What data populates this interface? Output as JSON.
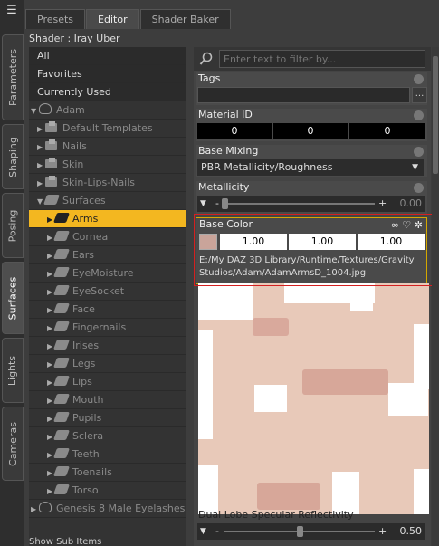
{
  "tabs": [
    "Presets",
    "Editor",
    "Shader Baker"
  ],
  "side_tabs": [
    "Parameters",
    "Shaping",
    "Posing",
    "Surfaces",
    "Lights",
    "Cameras"
  ],
  "shader_label": "Shader : Iray Uber",
  "tree": {
    "all": "All",
    "favorites": "Favorites",
    "currently_used": "Currently Used",
    "figure": "Adam",
    "folders": [
      "Default Templates",
      "Nails",
      "Skin",
      "Skin-Lips-Nails"
    ],
    "surfaces": "Surfaces",
    "selected": "Arms",
    "items": [
      "Cornea",
      "Ears",
      "EyeMoisture",
      "EyeSocket",
      "Face",
      "Fingernails",
      "Irises",
      "Legs",
      "Lips",
      "Mouth",
      "Pupils",
      "Sclera",
      "Teeth",
      "Toenails",
      "Torso"
    ],
    "next_figure": "Genesis 8 Male Eyelashes",
    "show_sub_items": "Show Sub Items"
  },
  "search": {
    "placeholder": "Enter text to filter by..."
  },
  "props": {
    "tags": {
      "label": "Tags",
      "button": "..."
    },
    "material_id": {
      "label": "Material ID",
      "values": [
        "0",
        "0",
        "0"
      ]
    },
    "base_mixing": {
      "label": "Base Mixing",
      "value": "PBR Metallicity/Roughness"
    },
    "metallicity": {
      "label": "Metallicity",
      "value": "0.00",
      "minus": "-",
      "plus": "+",
      "level": 0.0
    },
    "base_color": {
      "label": "Base Color",
      "values": [
        "1.00",
        "1.00",
        "1.00"
      ],
      "path": "E:/My DAZ 3D Library/Runtime/Textures/Gravity Studios/Adam/AdamArmsD_1004.jpg"
    },
    "dual_lobe": {
      "label": "Dual Lobe Specular Reflectivity",
      "value": "0.50",
      "level": 0.5
    }
  },
  "colors": {
    "selection": "#f3b720",
    "highlight_border": "#d4a800",
    "red_annotation": "#d42020"
  }
}
